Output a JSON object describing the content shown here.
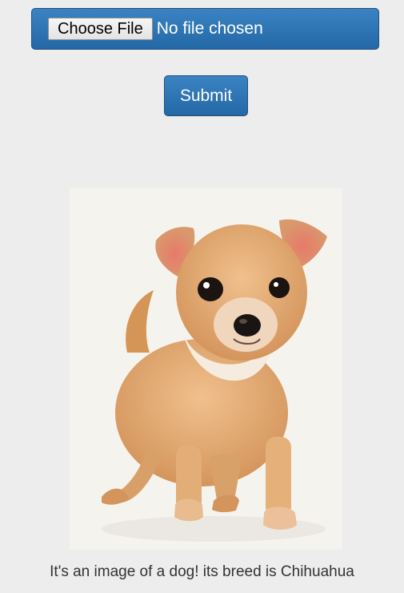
{
  "upload": {
    "choose_label": "Choose File",
    "status_text": "No file chosen"
  },
  "submit": {
    "label": "Submit"
  },
  "result": {
    "caption": "It's an image of a dog! its breed is Chihuahua"
  },
  "colors": {
    "button_blue": "#2d74b4",
    "page_background": "#ededed",
    "caption_text": "#333333"
  }
}
